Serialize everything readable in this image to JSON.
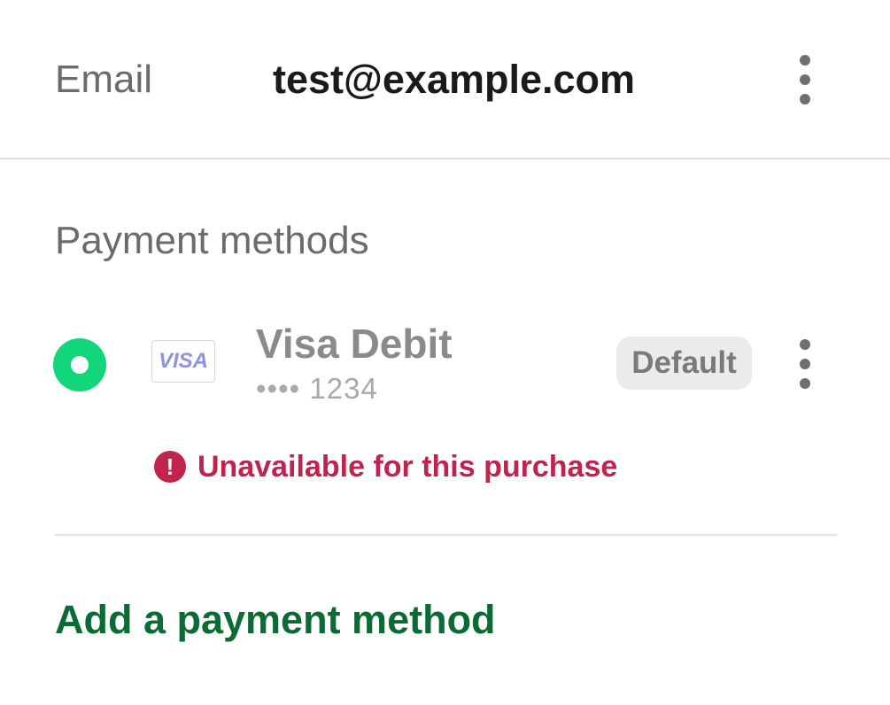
{
  "email": {
    "label": "Email",
    "value": "test@example.com"
  },
  "payment_methods": {
    "title": "Payment methods",
    "items": [
      {
        "brand_logo": "VISA",
        "name": "Visa Debit",
        "number_masked": "•••• 1234",
        "badge": "Default",
        "selected": true,
        "error": {
          "icon": "!",
          "message": "Unavailable for this purchase"
        }
      }
    ],
    "add_link": "Add a payment method"
  },
  "icons": {
    "more": "more-vertical-icon",
    "error": "error-circle-icon",
    "radio": "radio-selected-icon"
  },
  "colors": {
    "radio_selected": "#12d67a",
    "error": "#c0234b",
    "link": "#0a6b35",
    "visa_logo": "#8c93e2"
  }
}
